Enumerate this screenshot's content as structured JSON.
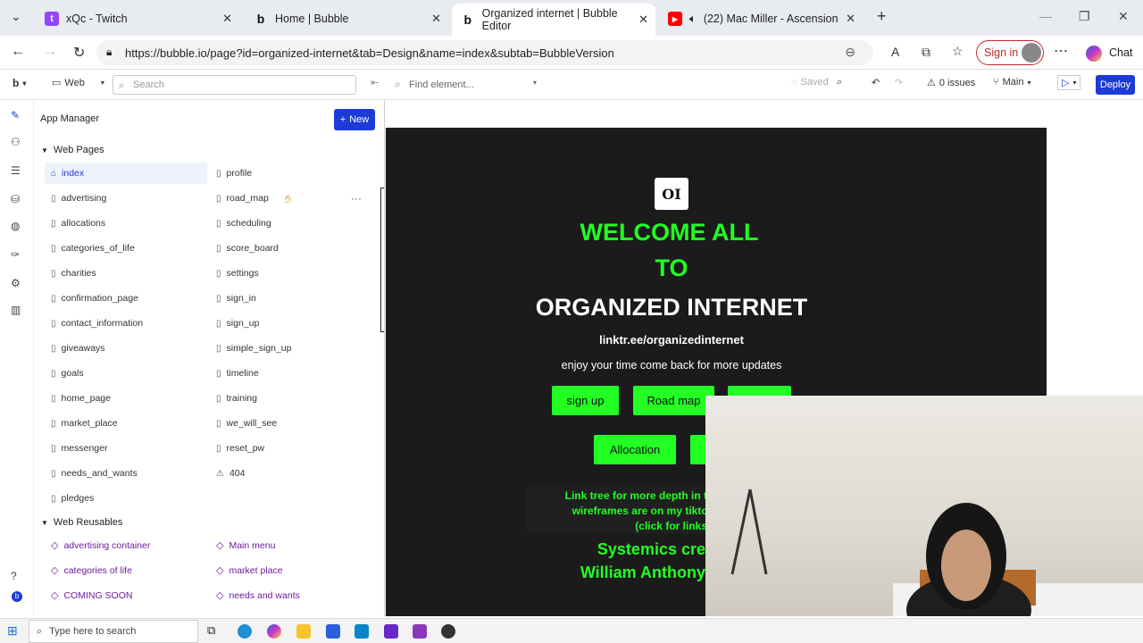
{
  "browser": {
    "tabs": [
      {
        "title": "xQc - Twitch",
        "icon": "twitch-icon"
      },
      {
        "title": "Home | Bubble",
        "icon": "bubble-icon"
      },
      {
        "title": "Organized internet | Bubble Editor",
        "icon": "bubble-icon"
      },
      {
        "title": "(22) Mac Miller - Ascension",
        "icon": "youtube-icon"
      }
    ],
    "url": "https://bubble.io/page?id=organized-internet&tab=Design&name=index&subtab=BubbleVersion",
    "sign_in": "Sign in",
    "chat": "Chat"
  },
  "toolbar": {
    "logo": "b",
    "platform": "Web",
    "search_placeholder": "Search",
    "find_placeholder": "Find element...",
    "saved": "Saved",
    "issues": "0 issues",
    "branch": "Main",
    "deploy": "Deploy"
  },
  "app_manager": {
    "title": "App Manager",
    "new_label": "New",
    "pages_section": "Web Pages",
    "pages_col1": [
      "index",
      "advertising",
      "allocations",
      "categories_of_life",
      "charities",
      "confirmation_page",
      "contact_information",
      "giveaways",
      "goals",
      "home_page",
      "market_place",
      "messenger",
      "needs_and_wants",
      "pledges"
    ],
    "pages_col2": [
      "profile",
      "road_map",
      "scheduling",
      "score_board",
      "settings",
      "sign_in",
      "sign_up",
      "simple_sign_up",
      "timeline",
      "training",
      "we_will_see",
      "reset_pw",
      "404"
    ],
    "reusables_section": "Web Reusables",
    "reusables_col1": [
      "advertising container",
      "categories of life",
      "COMING SOON"
    ],
    "reusables_col2": [
      "Main menu",
      "market place",
      "needs and wants"
    ]
  },
  "canvas": {
    "logo_text": "OI",
    "welcome_line1": "WELCOME ALL",
    "welcome_line2": "TO",
    "headline": "ORGANIZED INTERNET",
    "link": "linktr.ee/organizedinternet",
    "tagline": "enjoy your time come back for more updates",
    "buttons_row1": [
      "sign up",
      "Road map"
    ],
    "buttons_row2": [
      "Allocation"
    ],
    "note_line1": "Link tree for more depth in t",
    "note_line2": "wireframes are on my tiktc",
    "note_line3": "(click for links",
    "credit_line1": "Systemics cre",
    "credit_line2": "William Anthony"
  },
  "taskbar": {
    "search_placeholder": "Type here to search"
  },
  "colors": {
    "accent_blue": "#1d3bd6",
    "neon_green": "#22ff22",
    "canvas_dark": "#1b1b1b",
    "reusable_purple": "#6a1b9a"
  }
}
